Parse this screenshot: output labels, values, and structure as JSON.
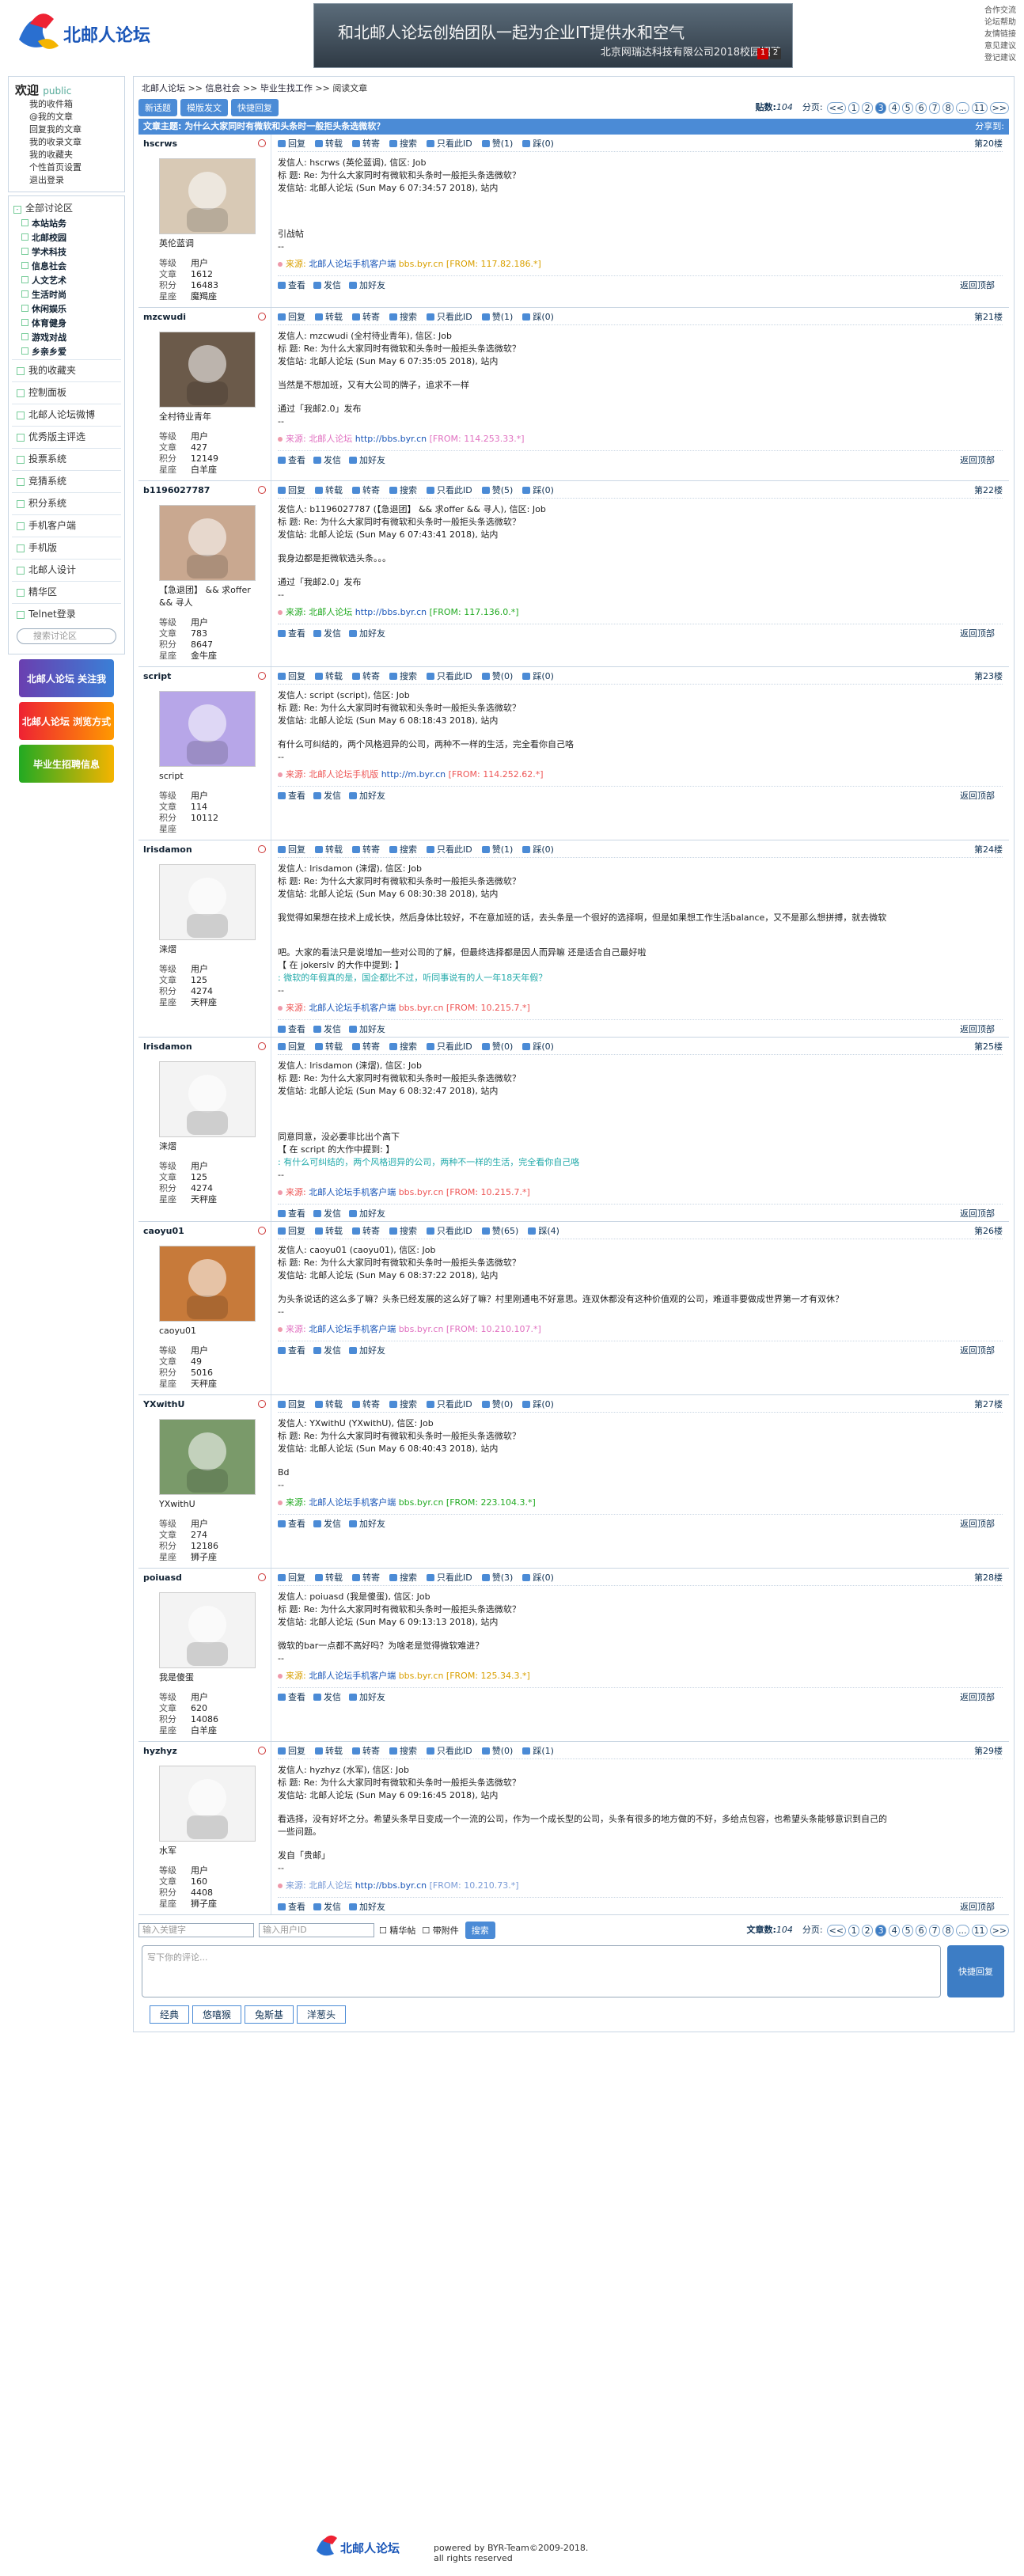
{
  "header": {
    "logo_text": "北邮人论坛",
    "banner": {
      "line1": "和北邮人论坛创始团队一起为企业IT提供水和空气",
      "line2": "北京网瑞达科技有限公司2018校园招聘",
      "pages": [
        "1",
        "2"
      ]
    },
    "toplinks": [
      "合作交流",
      "论坛帮助",
      "友情链接",
      "意见建议",
      "登记建议"
    ]
  },
  "sidebar": {
    "welcome_title": "欢迎",
    "welcome_user": "public",
    "links": [
      "我的收件箱",
      "@我的文章",
      "回复我的文章",
      "我的收录文章",
      "我的收藏夹",
      "个性首页设置",
      "退出登录"
    ],
    "section_head": "全部讨论区",
    "sections": [
      "本站站务",
      "北邮校园",
      "学术科技",
      "信息社会",
      "人文艺术",
      "生活时尚",
      "休闲娱乐",
      "体育健身",
      "游戏对战",
      "乡亲乡爱"
    ],
    "items": [
      "我的收藏夹",
      "控制面板",
      "北邮人论坛微博",
      "优秀版主评选",
      "投票系统",
      "竞猜系统",
      "积分系统",
      "手机客户端",
      "手机版",
      "北邮人设计",
      "精华区",
      "Telnet登录"
    ],
    "search_placeholder": "搜索讨论区",
    "promo1": "北邮人论坛 关注我",
    "promo2": "北邮人论坛 浏览方式",
    "promo3": "毕业生招聘信息"
  },
  "main": {
    "breadcrumb": [
      "北邮人论坛",
      ">>",
      "信息社会",
      ">>",
      "毕业生找工作",
      ">>",
      "阅读文章"
    ],
    "buttons": [
      "新话题",
      "模版发文",
      "快捷回复"
    ],
    "post_count_label": "贴数:",
    "post_count": "104",
    "page_label": "分页:",
    "pages": [
      "<<",
      "1",
      "2",
      "3",
      "4",
      "5",
      "6",
      "7",
      "8",
      "...",
      "11",
      ">>"
    ],
    "current_page": "3",
    "title_prefix": "文章主题:",
    "title": "为什么大家同时有微软和头条时一般拒头条选微软？",
    "share": "分享到:",
    "action_labels": {
      "reply": "回复",
      "forward": "转载",
      "transfer": "转寄",
      "search": "搜索",
      "only": "只看此ID",
      "up": "赞",
      "down": "踩",
      "view": "查看",
      "mail": "发信",
      "friend": "加好友",
      "top": "返回顶部"
    },
    "stat_labels": {
      "level": "等级",
      "posts": "文章",
      "score": "积分",
      "star": "星座"
    }
  },
  "posts": [
    {
      "user": "hscrws",
      "floor": "第20楼",
      "display": "英伦蓝调",
      "level": "用户",
      "posts": "1612",
      "score": "16483",
      "star": "魔羯座",
      "up": "1",
      "down": "0",
      "lines": [
        "发信人: hscrws (英伦蓝调), 信区: Job",
        "标  题: Re: 为什么大家同时有微软和头条时一般拒头条选微软？",
        "发信站: 北邮人论坛 (Sun May  6 07:34:57 2018), 站内",
        "",
        "",
        "",
        "引战帖",
        "--"
      ],
      "src_prefix": "来源: ",
      "src_link": "北邮人论坛手机客户端",
      "src_mid": " bbs.byr.cn",
      "src_ip": " [FROM: 117.82.186.*]",
      "src_color": "#d9a000"
    },
    {
      "user": "mzcwudi",
      "floor": "第21楼",
      "display": "全村待业青年",
      "level": "用户",
      "posts": "427",
      "score": "12149",
      "star": "白羊座",
      "up": "1",
      "down": "0",
      "lines": [
        "发信人: mzcwudi (全村待业青年), 信区: Job",
        "标  题: Re: 为什么大家同时有微软和头条时一般拒头条选微软？",
        "发信站: 北邮人论坛 (Sun May  6 07:35:05 2018), 站内",
        "",
        "当然是不想加班，又有大公司的牌子，追求不一样",
        "",
        "通过「我邮2.0」发布",
        "--"
      ],
      "src_prefix": "来源: 北邮人论坛 ",
      "src_link": "http://bbs.byr.cn",
      "src_mid": "",
      "src_ip": " [FROM: 114.253.33.*]",
      "src_color": "#e070c0"
    },
    {
      "user": "b1196027787",
      "floor": "第22楼",
      "display": "【急退团】 && 求offer && 寻人",
      "level": "用户",
      "posts": "783",
      "score": "8647",
      "star": "金牛座",
      "up": "5",
      "down": "0",
      "lines": [
        "发信人: b1196027787 (【急退团】 && 求offer  && 寻人), 信区: Job",
        "标  题: Re: 为什么大家同时有微软和头条时一般拒头条选微软？",
        "发信站: 北邮人论坛 (Sun May  6 07:43:41 2018), 站内",
        "",
        "我身边都是拒微软选头条。。。",
        "",
        "通过「我邮2.0」发布",
        "--"
      ],
      "src_prefix": "来源: 北邮人论坛 ",
      "src_link": "http://bbs.byr.cn",
      "src_mid": "",
      "src_ip": " [FROM: 117.136.0.*]",
      "src_color": "#2a2"
    },
    {
      "user": "script",
      "floor": "第23楼",
      "display": "script",
      "level": "用户",
      "posts": "114",
      "score": "10112",
      "star": "",
      "up": "0",
      "down": "0",
      "lines": [
        "发信人: script (script), 信区: Job",
        "标  题: Re: 为什么大家同时有微软和头条时一般拒头条选微软？",
        "发信站: 北邮人论坛 (Sun May  6 08:18:43 2018), 站内",
        "",
        "有什么可纠结的，两个风格迥异的公司，两种不一样的生活，完全看你自己咯",
        "--"
      ],
      "src_prefix": "来源: 北邮人论坛手机版 ",
      "src_link": "http://m.byr.cn",
      "src_mid": "",
      "src_ip": " [FROM: 114.252.62.*]",
      "src_color": "#e55"
    },
    {
      "user": "lrisdamon",
      "floor": "第24楼",
      "display": "涞熠",
      "level": "用户",
      "posts": "125",
      "score": "4274",
      "star": "天秤座",
      "up": "1",
      "down": "0",
      "lines": [
        "发信人: lrisdamon (涞熠), 信区: Job",
        "标  题: Re: 为什么大家同时有微软和头条时一般拒头条选微软？",
        "发信站: 北邮人论坛 (Sun May  6 08:30:38 2018), 站内",
        "",
        "我觉得如果想在技术上成长快，然后身体比较好，不在意加班的话，去头条是一个很好的选择啊，但是如果想工作生活balance，又不是那么想拼搏，就去微软",
        "",
        "",
        "吧。大家的看法只是说增加一些对公司的了解，但最终选择都是因人而异嘛 还是适合自己最好啦",
        "【 在 jokerslv 的大作中提到: 】"
      ],
      "quote": ": 微软的年假真的是，国企都比不过，听同事说有的人一年18天年假？",
      "lines2": [
        "--"
      ],
      "src_prefix": "来源: ",
      "src_link": "北邮人论坛手机客户端",
      "src_mid": " bbs.byr.cn",
      "src_ip": " [FROM: 10.215.7.*]",
      "src_color": "#e55"
    },
    {
      "user": "lrisdamon",
      "floor": "第25楼",
      "display": "涞熠",
      "level": "用户",
      "posts": "125",
      "score": "4274",
      "star": "天秤座",
      "up": "0",
      "down": "0",
      "lines": [
        "发信人: lrisdamon (涞熠), 信区: Job",
        "标  题: Re: 为什么大家同时有微软和头条时一般拒头条选微软？",
        "发信站: 北邮人论坛 (Sun May  6 08:32:47 2018), 站内",
        "",
        "",
        "",
        "同意同意，没必要非比出个高下",
        "【 在 script 的大作中提到: 】"
      ],
      "quote": ": 有什么可纠结的，两个风格迥异的公司，两种不一样的生活，完全看你自己咯",
      "lines2": [
        "--"
      ],
      "src_prefix": "来源: ",
      "src_link": "北邮人论坛手机客户端",
      "src_mid": " bbs.byr.cn",
      "src_ip": " [FROM: 10.215.7.*]",
      "src_color": "#e55"
    },
    {
      "user": "caoyu01",
      "floor": "第26楼",
      "display": "caoyu01",
      "level": "用户",
      "posts": "49",
      "score": "5016",
      "star": "天秤座",
      "up": "65",
      "down": "4",
      "lines": [
        "发信人: caoyu01 (caoyu01), 信区: Job",
        "标  题: Re: 为什么大家同时有微软和头条时一般拒头条选微软？",
        "发信站: 北邮人论坛 (Sun May  6 08:37:22 2018), 站内",
        "",
        "为头条说话的这么多了嘛？头条已经发展的这么好了嘛？村里刚通电不好意思。连双休都没有这种价值观的公司，难道非要做成世界第一才有双休？",
        "--"
      ],
      "src_prefix": "来源: ",
      "src_link": "北邮人论坛手机客户端",
      "src_mid": " bbs.byr.cn",
      "src_ip": " [FROM: 10.210.107.*]",
      "src_color": "#e070c0"
    },
    {
      "user": "YXwithU",
      "floor": "第27楼",
      "display": "YXwithU",
      "level": "用户",
      "posts": "274",
      "score": "12186",
      "star": "狮子座",
      "up": "0",
      "down": "0",
      "lines": [
        "发信人: YXwithU (YXwithU), 信区: Job",
        "标  题: Re: 为什么大家同时有微软和头条时一般拒头条选微软？",
        "发信站: 北邮人论坛 (Sun May  6 08:40:43 2018), 站内",
        "",
        "Bd",
        "--"
      ],
      "src_prefix": "来源: ",
      "src_link": "北邮人论坛手机客户端",
      "src_mid": " bbs.byr.cn",
      "src_ip": " [FROM: 223.104.3.*]",
      "src_color": "#2a2"
    },
    {
      "user": "poiuasd",
      "floor": "第28楼",
      "display": "我是傻蛋",
      "level": "用户",
      "posts": "620",
      "score": "14086",
      "star": "白羊座",
      "up": "3",
      "down": "0",
      "lines": [
        "发信人: poiuasd (我是傻蛋), 信区: Job",
        "标  题: Re: 为什么大家同时有微软和头条时一般拒头条选微软？",
        "发信站: 北邮人论坛 (Sun May  6 09:13:13 2018), 站内",
        "",
        "微软的bar一点都不高好吗？为啥老是觉得微软难进？",
        "--"
      ],
      "src_prefix": "来源: ",
      "src_link": "北邮人论坛手机客户端",
      "src_mid": " bbs.byr.cn",
      "src_ip": " [FROM: 125.34.3.*]",
      "src_color": "#d9a000"
    },
    {
      "user": "hyzhyz",
      "floor": "第29楼",
      "display": "水军",
      "level": "用户",
      "posts": "160",
      "score": "4408",
      "star": "狮子座",
      "up": "0",
      "down": "1",
      "lines": [
        "发信人: hyzhyz (水军), 信区: Job",
        "标  题: Re: 为什么大家同时有微软和头条时一般拒头条选微软？",
        "发信站: 北邮人论坛 (Sun May  6 09:16:45 2018), 站内",
        "",
        "看选择，没有好坏之分。希望头条早日变成一个一流的公司，作为一个成长型的公司，头条有很多的地方做的不好，多给点包容，也希望头条能够意识到自己的",
        "一些问题。",
        "",
        "发自「贵邮」",
        "--"
      ],
      "src_prefix": "来源: 北邮人论坛 ",
      "src_link": "http://bbs.byr.cn",
      "src_mid": "",
      "src_ip": " [FROM: 10.210.73.*]",
      "src_color": "#7a9bd6"
    }
  ],
  "bottom": {
    "keyword_placeholder": "输入关键字",
    "user_placeholder": "输入用户ID",
    "elite_label": "精华帖",
    "attach_label": "带附件",
    "search_btn": "搜索",
    "post_count_label": "文章数:",
    "post_count": "104",
    "page_label": "分页:",
    "reply_placeholder": "写下你的评论...",
    "quick_reply": "快捷回复",
    "emoji_tabs": [
      "经典",
      "悠嘻猴",
      "兔斯基",
      "洋葱头"
    ]
  },
  "footer": {
    "powered": "powered by BYR-Team©2009-2018.",
    "rights": "all rights reserved"
  },
  "colors": {
    "accent": "#4b8bd6",
    "border": "#c9d6e3"
  }
}
